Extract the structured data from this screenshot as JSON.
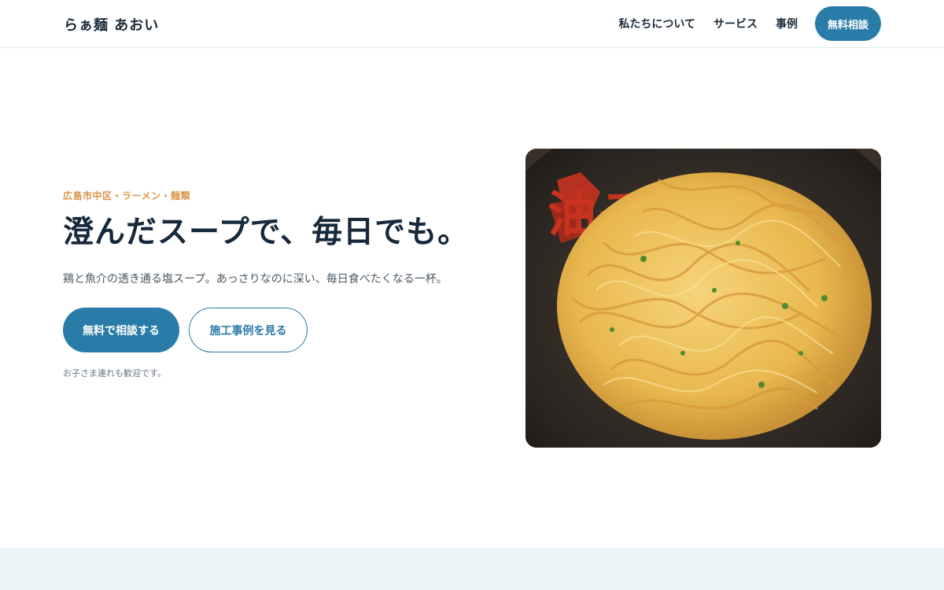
{
  "brand": {
    "logo": "らぁ麺 あおい"
  },
  "nav": {
    "items": [
      {
        "label": "私たちについて"
      },
      {
        "label": "サービス"
      },
      {
        "label": "事例"
      }
    ],
    "cta": "無料相談"
  },
  "hero": {
    "eyebrow": "広島市中区・ラーメン・麺類",
    "headline": "澄んだスープで、毎日でも。",
    "lead": "鶏と魚介の透き通る塩スープ。あっさりなのに深い、毎日食べたくなる一杯。",
    "primary_button": "無料で相談する",
    "secondary_button": "施工事例を見る",
    "note": "お子さま連れも歓迎です。",
    "image": {
      "bowl_lettering": "油そば"
    }
  },
  "colors": {
    "accent": "#2a7ca8",
    "eyebrow": "#d9944a",
    "text": "#16283a",
    "band": "#ecf4f7"
  }
}
